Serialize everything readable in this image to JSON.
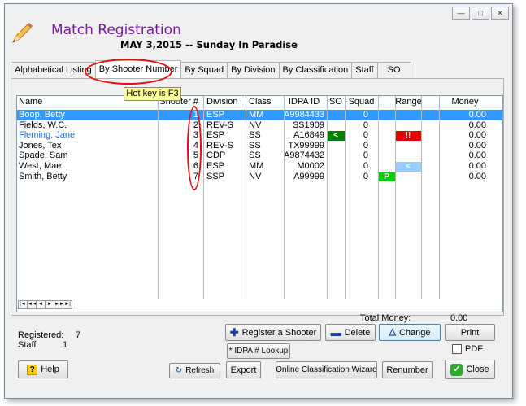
{
  "window": {
    "controls": [
      "—",
      "□",
      "✕"
    ],
    "title": "Match Registration",
    "match_name": "MAY  3,2015 -- Sunday In Paradise"
  },
  "tabs": [
    {
      "label": "Alphabetical Listing",
      "active": false
    },
    {
      "label": "By Shooter Number",
      "active": true
    },
    {
      "label": "By Squad",
      "active": false
    },
    {
      "label": "By Division",
      "active": false
    },
    {
      "label": "By Classification",
      "active": false
    },
    {
      "label": "Staff",
      "active": false
    },
    {
      "label": "SO",
      "active": false
    }
  ],
  "tooltip": "Hot key is F3",
  "grid": {
    "columns": [
      "Name",
      "Shooter #",
      "Division",
      "Class",
      "IDPA ID",
      "SO",
      "Squad",
      "Range",
      "Money"
    ],
    "rows": [
      {
        "name": "Boop, Betty",
        "num": "1",
        "division": "ESP",
        "class": "MM",
        "idpa": "A9984433",
        "so": "",
        "squad": "0",
        "range1": "",
        "range2": "",
        "range3": "",
        "money": "0.00",
        "selected": true,
        "highlight": false
      },
      {
        "name": "Fields, W.C.",
        "num": "2",
        "division": "REV-S",
        "class": "NV",
        "idpa": "SS1909",
        "so": "",
        "squad": "0",
        "range1": "",
        "range2": "",
        "range3": "",
        "money": "0.00",
        "selected": false,
        "highlight": false
      },
      {
        "name": "Fleming, Jane",
        "num": "3",
        "division": "ESP",
        "class": "SS",
        "idpa": "A16849",
        "so": "<",
        "squad": "0",
        "range1": "",
        "range2": "!!",
        "range3": "",
        "money": "0.00",
        "selected": false,
        "highlight": true
      },
      {
        "name": "Jones, Tex",
        "num": "4",
        "division": "REV-S",
        "class": "SS",
        "idpa": "TX99999",
        "so": "",
        "squad": "0",
        "range1": "",
        "range2": "",
        "range3": "",
        "money": "0.00",
        "selected": false,
        "highlight": false
      },
      {
        "name": "Spade, Sam",
        "num": "5",
        "division": "CDP",
        "class": "SS",
        "idpa": "A9874432",
        "so": "",
        "squad": "0",
        "range1": "",
        "range2": "",
        "range3": "",
        "money": "0.00",
        "selected": false,
        "highlight": false
      },
      {
        "name": "West, Mae",
        "num": "6",
        "division": "ESP",
        "class": "MM",
        "idpa": "M0002",
        "so": "",
        "squad": "0",
        "range1": "",
        "range2": "<",
        "range3": "",
        "money": "0.00",
        "selected": false,
        "highlight": false
      },
      {
        "name": "Smith, Betty",
        "num": "7",
        "division": "SSP",
        "class": "NV",
        "idpa": "A99999",
        "so": "",
        "squad": "0",
        "range1": "P",
        "range2": "",
        "range3": "",
        "money": "0.00",
        "selected": false,
        "highlight": false
      }
    ],
    "nav": [
      "|◄",
      "◄◄",
      "◄",
      "►",
      "►►",
      "►|"
    ]
  },
  "summary": {
    "total_money_label": "Total Money:",
    "total_money_value": "0.00",
    "registered_label": "Registered:",
    "registered_value": "7",
    "staff_label": "Staff:",
    "staff_value": "1"
  },
  "buttons": {
    "register": "Register a Shooter",
    "delete": "Delete",
    "change": "Change",
    "print": "Print",
    "pdf": "PDF",
    "idpa_lookup": "* IDPA # Lookup",
    "help": "Help",
    "refresh": "Refresh",
    "export": "Export",
    "wizard": "Online Classification Wizard",
    "renumber": "Renumber",
    "close": "Close"
  },
  "colors": {
    "selected": "#3399ff",
    "title": "#7a1aa0",
    "annotation": "#e01010",
    "so_badge": "#008000",
    "alert_badge": "#e00000",
    "range_badge": "#99ccff",
    "p_badge": "#00cc00",
    "highlight_text": "#1e6fd9"
  }
}
